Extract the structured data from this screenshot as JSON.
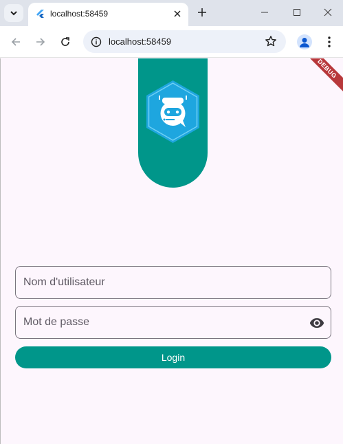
{
  "browser": {
    "tab_title": "localhost:58459",
    "url": "localhost:58459"
  },
  "app": {
    "debug_label": "DEBUG",
    "username_placeholder": "Nom d'utilisateur",
    "password_placeholder": "Mot de passe",
    "login_label": "Login",
    "colors": {
      "primary": "#00968a",
      "logo_blue": "#1ea6df",
      "background": "#fdf6fd",
      "debug": "#b8383b"
    }
  }
}
